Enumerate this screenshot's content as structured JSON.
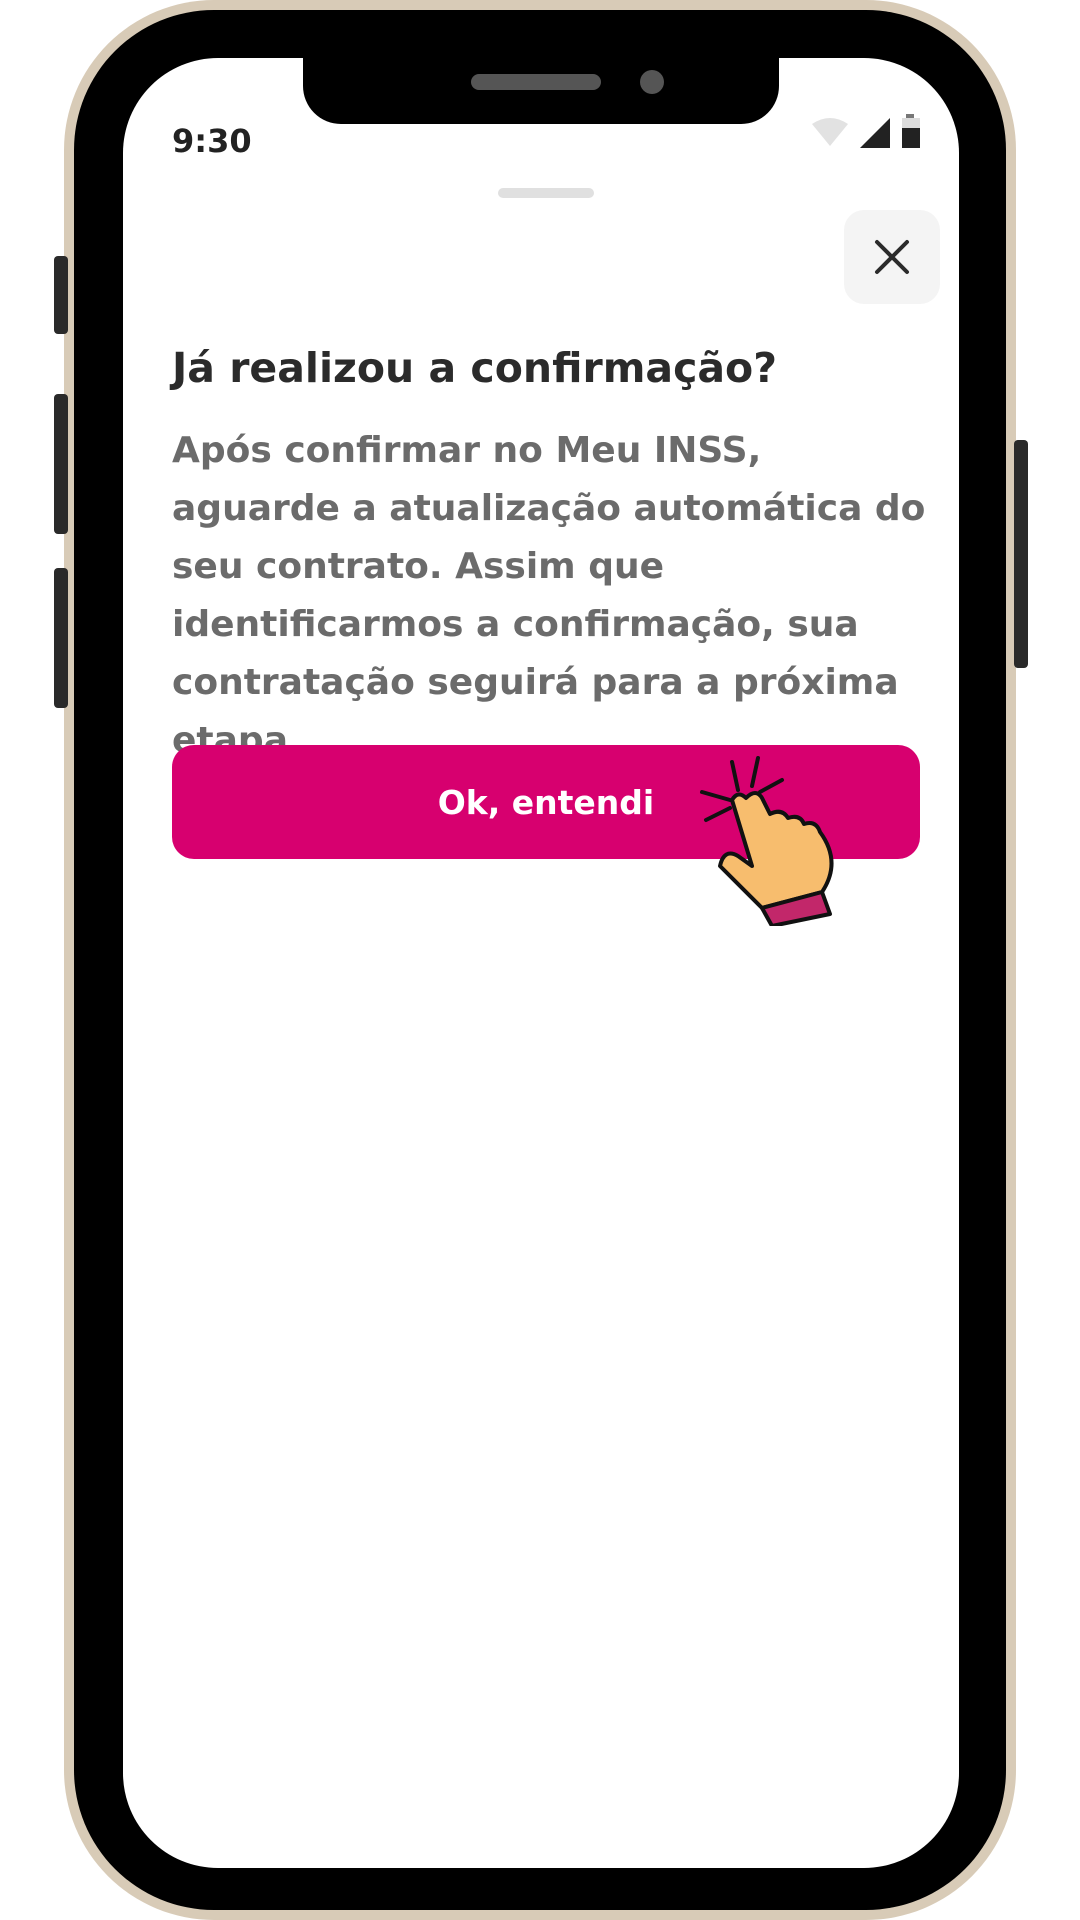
{
  "status_bar": {
    "time": "9:30",
    "icons": [
      "wifi-icon",
      "signal-icon",
      "battery-icon"
    ]
  },
  "sheet": {
    "title": "Já realizou a confirmação?",
    "body": "Após confirmar no Meu INSS, aguarde a atualização automática do seu contrato. Assim que identificarmos a confirmação, sua contratação seguirá para a próxima etapa.",
    "primary_button_label": "Ok, entendi",
    "close_icon": "close-icon"
  },
  "colors": {
    "accent": "#d7006f",
    "frame": "#d8cbb7",
    "title_text": "#2b2b2b",
    "body_text": "#6b6b6b"
  }
}
